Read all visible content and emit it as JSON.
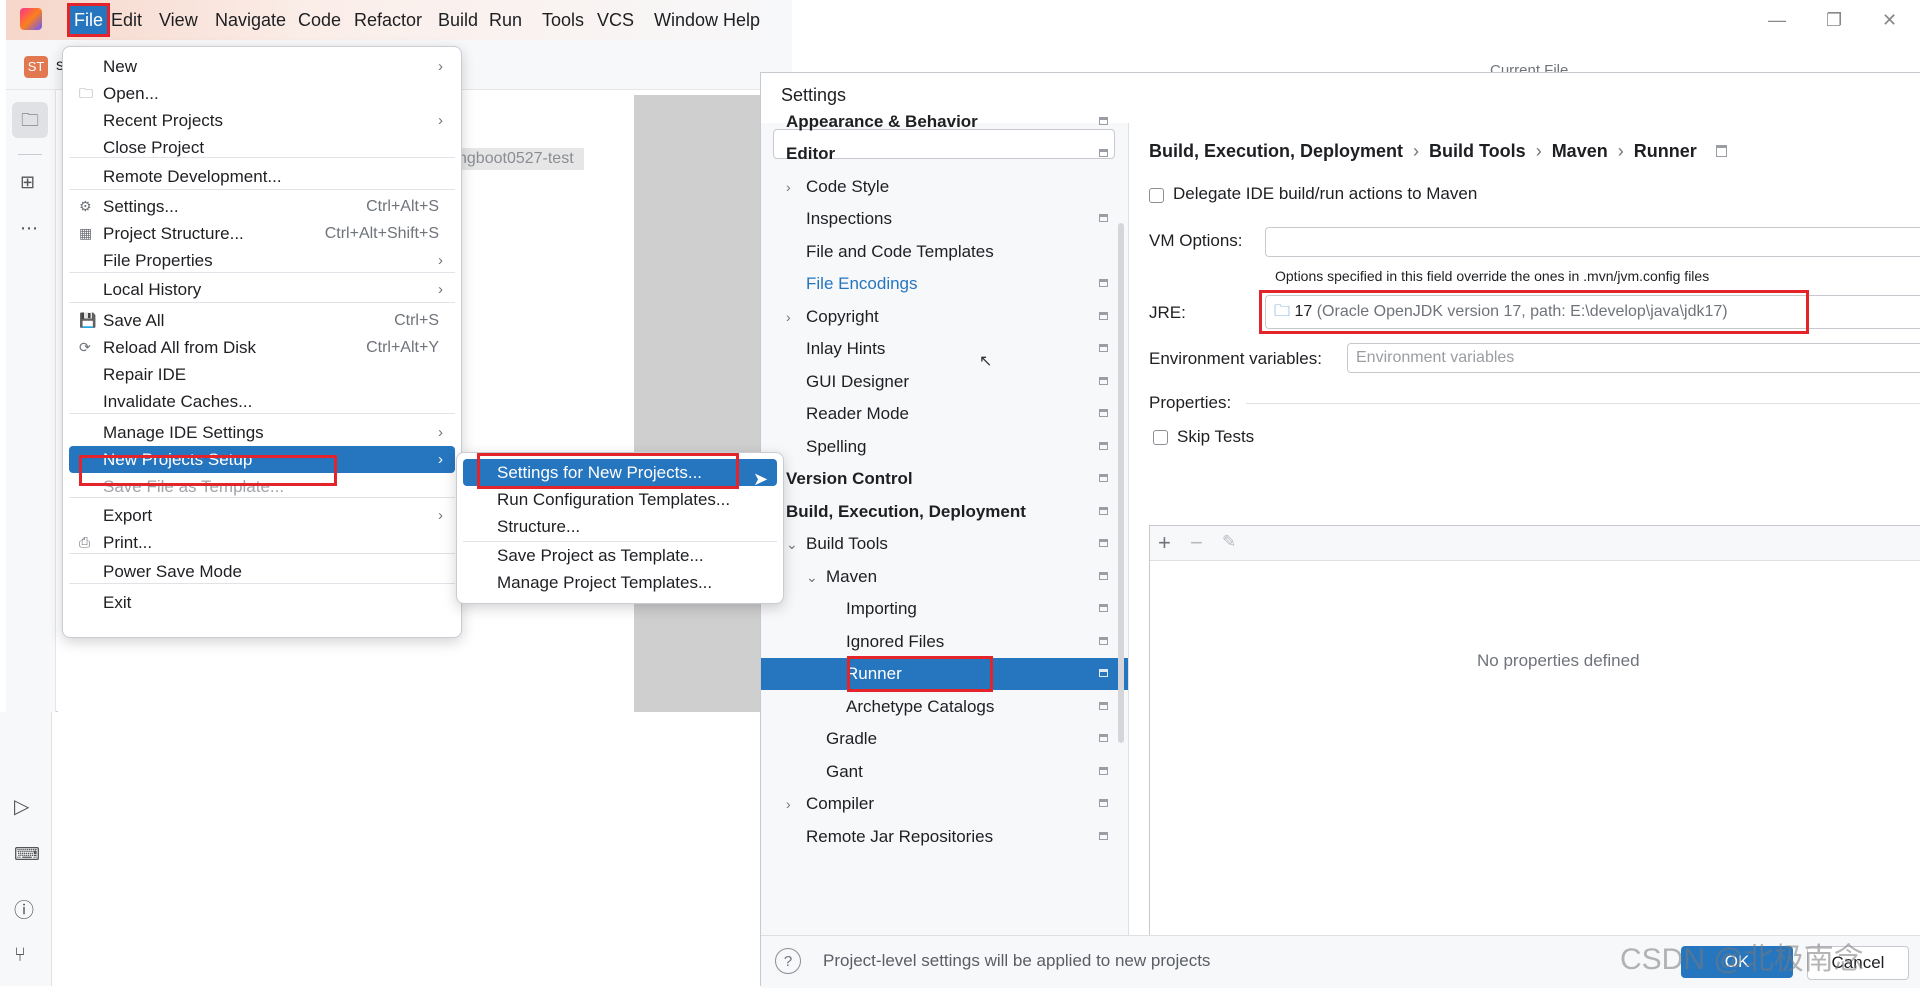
{
  "ide": {
    "menu": [
      "File",
      "Edit",
      "View",
      "Navigate",
      "Code",
      "Refactor",
      "Build",
      "Run",
      "Tools",
      "VCS",
      "Window",
      "Help"
    ],
    "project_badge": "ST",
    "project_tab_partial": "s",
    "editor_partial_text": "ngboot0527-test",
    "current_file_partial": "Current File"
  },
  "file_menu": {
    "items": [
      {
        "label": "New",
        "arrow": "›"
      },
      {
        "label": "Open...",
        "icon": "folder-icon"
      },
      {
        "label": "Recent Projects",
        "arrow": "›"
      },
      {
        "label": "Close Project"
      },
      {
        "label": "Remote Development..."
      },
      {
        "label": "Settings...",
        "shortcut": "Ctrl+Alt+S",
        "icon": "gear-icon"
      },
      {
        "label": "Project Structure...",
        "shortcut": "Ctrl+Alt+Shift+S",
        "icon": "project-structure-icon"
      },
      {
        "label": "File Properties",
        "arrow": "›"
      },
      {
        "label": "Local History",
        "arrow": "›"
      },
      {
        "label": "Save All",
        "shortcut": "Ctrl+S",
        "icon": "save-icon"
      },
      {
        "label": "Reload All from Disk",
        "shortcut": "Ctrl+Alt+Y",
        "icon": "reload-icon"
      },
      {
        "label": "Repair IDE"
      },
      {
        "label": "Invalidate Caches..."
      },
      {
        "label": "Manage IDE Settings",
        "arrow": "›"
      },
      {
        "label": "New Projects Setup",
        "arrow": "›"
      },
      {
        "label": "Save File as Template..."
      },
      {
        "label": "Export",
        "arrow": "›"
      },
      {
        "label": "Print...",
        "icon": "print-icon"
      },
      {
        "label": "Power Save Mode"
      },
      {
        "label": "Exit"
      }
    ]
  },
  "submenu": {
    "items": [
      "Settings for New Projects...",
      "Run Configuration Templates...",
      "Structure...",
      "Save Project as Template...",
      "Manage Project Templates..."
    ]
  },
  "settings": {
    "title": "Settings",
    "search_placeholder": "",
    "tree": [
      "Appearance & Behavior",
      "Editor",
      "Code Style",
      "Inspections",
      "File and Code Templates",
      "File Encodings",
      "Copyright",
      "Inlay Hints",
      "GUI Designer",
      "Reader Mode",
      "Spelling",
      "Version Control",
      "Build, Execution, Deployment",
      "Build Tools",
      "Maven",
      "Importing",
      "Ignored Files",
      "Runner",
      "Archetype Catalogs",
      "Gradle",
      "Gant",
      "Compiler",
      "Remote Jar Repositories"
    ],
    "breadcrumb": [
      "Build, Execution, Deployment",
      "Build Tools",
      "Maven",
      "Runner"
    ],
    "delegate_label": "Delegate IDE build/run actions to Maven",
    "vm_options_label": "VM Options:",
    "vm_options_value": "",
    "vm_hint": "Options specified in this field override the ones in .mvn/jvm.config files",
    "jre_label": "JRE:",
    "jre_version": "17",
    "jre_detail": "(Oracle OpenJDK version 17, path: E:\\develop\\java\\jdk17)",
    "env_label": "Environment variables:",
    "env_placeholder": "Environment variables",
    "properties_label": "Properties:",
    "skip_tests_label": "Skip Tests",
    "no_properties": "No properties defined",
    "footer_text": "Project-level settings will be applied to new projects",
    "ok_label": "OK",
    "cancel_label": "Cancel",
    "help_icon": "?"
  },
  "watermark": "CSDN @北极南念",
  "colors": {
    "accent": "#2675bf",
    "highlight": "#e3242b",
    "link": "#2675bf"
  }
}
